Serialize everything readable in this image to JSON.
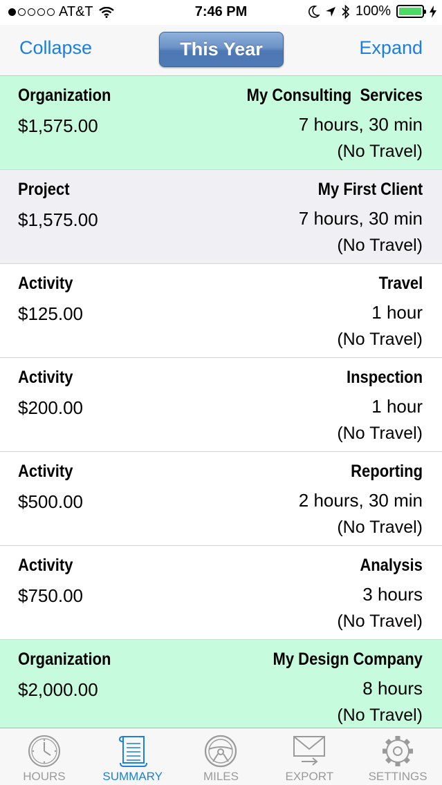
{
  "status_bar": {
    "carrier": "AT&T",
    "time": "7:46 PM",
    "battery": "100%",
    "signal_bars": 1,
    "icons": [
      "wifi-icon",
      "moon-icon",
      "location-arrow-icon",
      "bluetooth-icon",
      "battery-icon",
      "charging-icon"
    ]
  },
  "nav": {
    "left_label": "Collapse",
    "center_label": "This Year",
    "right_label": "Expand"
  },
  "rows": [
    {
      "kind": "org",
      "type": "Organization",
      "amount": "$1,575.00",
      "name": "My Consulting  Services",
      "duration": "7 hours, 30 min",
      "travel": "(No Travel)"
    },
    {
      "kind": "project",
      "type": "Project",
      "amount": "$1,575.00",
      "name": "My First Client",
      "duration": "7 hours, 30 min",
      "travel": "(No Travel)"
    },
    {
      "kind": "activity",
      "type": "Activity",
      "amount": "$125.00",
      "name": "Travel",
      "duration": "1 hour",
      "travel": "(No Travel)"
    },
    {
      "kind": "activity",
      "type": "Activity",
      "amount": "$200.00",
      "name": "Inspection",
      "duration": "1 hour",
      "travel": "(No Travel)"
    },
    {
      "kind": "activity",
      "type": "Activity",
      "amount": "$500.00",
      "name": "Reporting",
      "duration": "2 hours, 30 min",
      "travel": "(No Travel)"
    },
    {
      "kind": "activity",
      "type": "Activity",
      "amount": "$750.00",
      "name": "Analysis",
      "duration": "3 hours",
      "travel": "(No Travel)"
    },
    {
      "kind": "org",
      "type": "Organization",
      "amount": "$2,000.00",
      "name": "My Design Company",
      "duration": "8 hours",
      "travel": "(No Travel)"
    }
  ],
  "tabs": [
    {
      "label": "HOURS",
      "icon": "clock-icon",
      "active": false
    },
    {
      "label": "SUMMARY",
      "icon": "scroll-icon",
      "active": true
    },
    {
      "label": "MILES",
      "icon": "steering-wheel-icon",
      "active": false
    },
    {
      "label": "EXPORT",
      "icon": "envelope-icon",
      "active": false
    },
    {
      "label": "SETTINGS",
      "icon": "gear-icon",
      "active": false
    }
  ],
  "colors": {
    "accent": "#1a7fe0",
    "org_row": "#c6fbde",
    "project_row": "#efeff4",
    "tab_inactive": "#9a9a9a"
  }
}
